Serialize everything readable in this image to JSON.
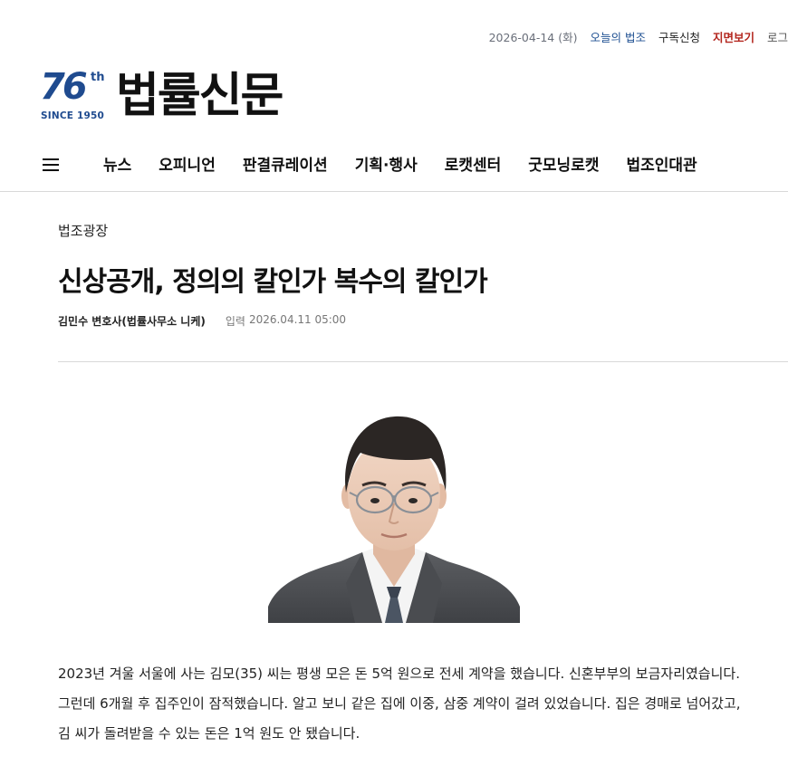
{
  "topbar": {
    "date": "2026-04-14 (화)",
    "today_law": "오늘의 법조",
    "subscribe": "구독신청",
    "print_view": "지면보기",
    "login": "로그"
  },
  "logo": {
    "anniversary_number": "76",
    "anniversary_suffix": "th",
    "since": "SINCE 1950",
    "name": "법률신문"
  },
  "nav": {
    "items": [
      "뉴스",
      "오피니언",
      "판결큐레이션",
      "기획·행사",
      "로캣센터",
      "굿모닝로캣",
      "법조인대관"
    ]
  },
  "article": {
    "section": "법조광장",
    "headline": "신상공개, 정의의 칼인가 복수의 칼인가",
    "author": "김민수 변호사(법률사무소 니케)",
    "published_label": "입력",
    "published_date": "2026.04.11 05:00",
    "body": "2023년 겨울 서울에 사는 김모(35) 씨는 평생 모은 돈 5억 원으로 전세 계약을 했습니다. 신혼부부의 보금자리였습니다. 그런데 6개월 후 집주인이 잠적했습니다. 알고 보니 같은 집에 이중, 삼중 계약이 걸려 있었습니다. 집은 경매로 넘어갔고, 김 씨가 돌려받을 수 있는 돈은 1억 원도 안 됐습니다."
  },
  "colors": {
    "brand_blue": "#1f4b8f",
    "nav_today": "#1d4f91",
    "print_red": "#b3261e",
    "divider": "#d9d9d9"
  }
}
